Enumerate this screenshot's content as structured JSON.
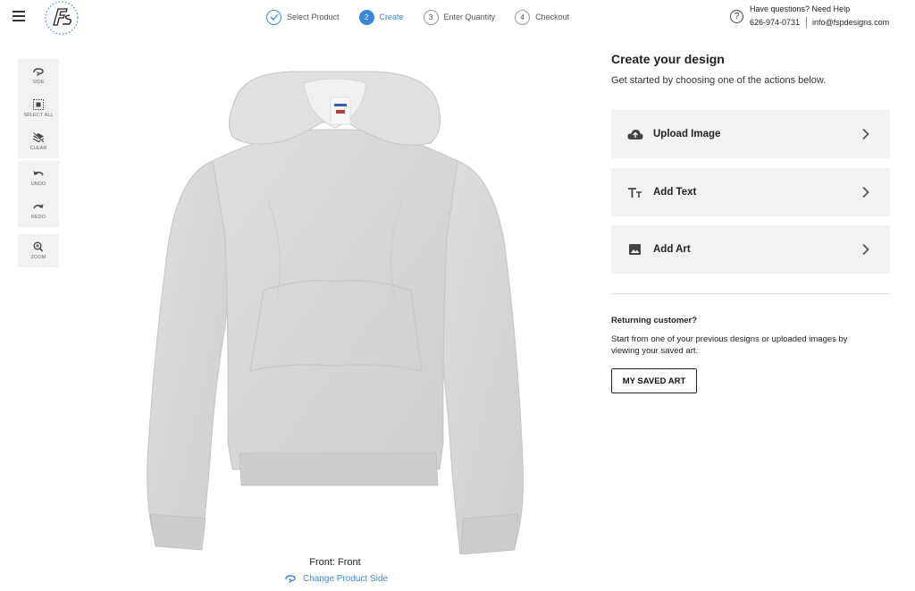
{
  "header": {
    "steps": [
      {
        "num": "✓",
        "label": "Select Product",
        "state": "done"
      },
      {
        "num": "2",
        "label": "Create",
        "state": "active"
      },
      {
        "num": "3",
        "label": "Enter Quantity",
        "state": "pending"
      },
      {
        "num": "4",
        "label": "Checkout",
        "state": "pending"
      }
    ],
    "help_title": "Have questions? Need Help",
    "help_phone": "626-974-0731",
    "help_email": "info@fspdesigns.com",
    "help_icon": "question-circle-icon"
  },
  "tools": {
    "side": "SIDE",
    "select_all": "SELECT ALL",
    "clear": "CLEAR",
    "undo": "UNDO",
    "redo": "REDO",
    "zoom": "ZOOM"
  },
  "product": {
    "caption": "Front: Front",
    "change_side": "Change Product Side",
    "garment_color": "#d9d9d9"
  },
  "panel": {
    "title": "Create your design",
    "subtitle": "Get started by choosing one of the actions below.",
    "actions": [
      {
        "label": "Upload Image",
        "icon": "cloud-upload-icon"
      },
      {
        "label": "Add Text",
        "icon": "text-icon"
      },
      {
        "label": "Add Art",
        "icon": "image-icon"
      }
    ],
    "returning_title": "Returning customer?",
    "returning_text": "Start from one of your previous designs or uploaded images by viewing your saved art.",
    "saved_art_button": "MY SAVED ART"
  },
  "colors": {
    "accent": "#3b86d9",
    "panel_bg": "#f2f2f2"
  }
}
